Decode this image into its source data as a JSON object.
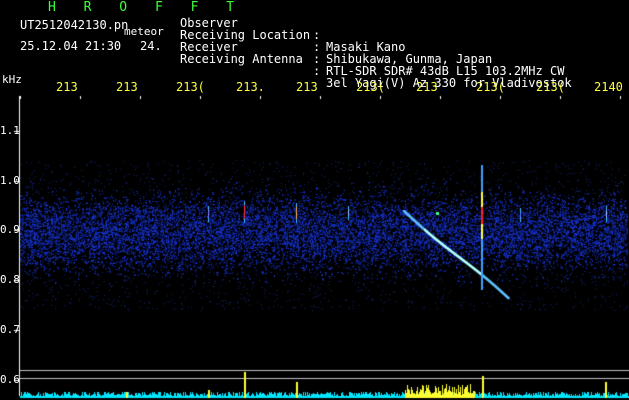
{
  "brand": "H R O F F T",
  "file": {
    "name": "UT2512042130.pn",
    "type_label": "meteor",
    "datetime": "25.12.04 21:30",
    "count": "24."
  },
  "header": [
    {
      "label": "Observer",
      "value": "Masaki Kano"
    },
    {
      "label": "Receiving Location",
      "value": "Shibukawa, Gunma, Japan"
    },
    {
      "label": "Receiver",
      "value": "RTL-SDR SDR# 43dB L15 103.2MHz CW"
    },
    {
      "label": "Receiving Antenna",
      "value": "3el Yagi(V) Az 330 for Vladivostok"
    }
  ],
  "y_axis": {
    "unit": "kHz",
    "ticks": [
      "1.1",
      "1.0",
      "0.9",
      "0.8",
      "0.7",
      "0.6"
    ]
  },
  "x_axis": {
    "ticks": [
      "213",
      "213",
      "213(",
      "213.",
      "213",
      "213(",
      "213",
      "213(",
      "213(",
      "2140"
    ]
  },
  "colors": {
    "text_green": "#3cff3c",
    "tick_yellow": "#ffff3c",
    "noise_blue": "#1e3cff",
    "trail_cyan": "#a0ffff",
    "echo_red": "#ff2020",
    "bottom_cyan": "#00ffff"
  }
}
